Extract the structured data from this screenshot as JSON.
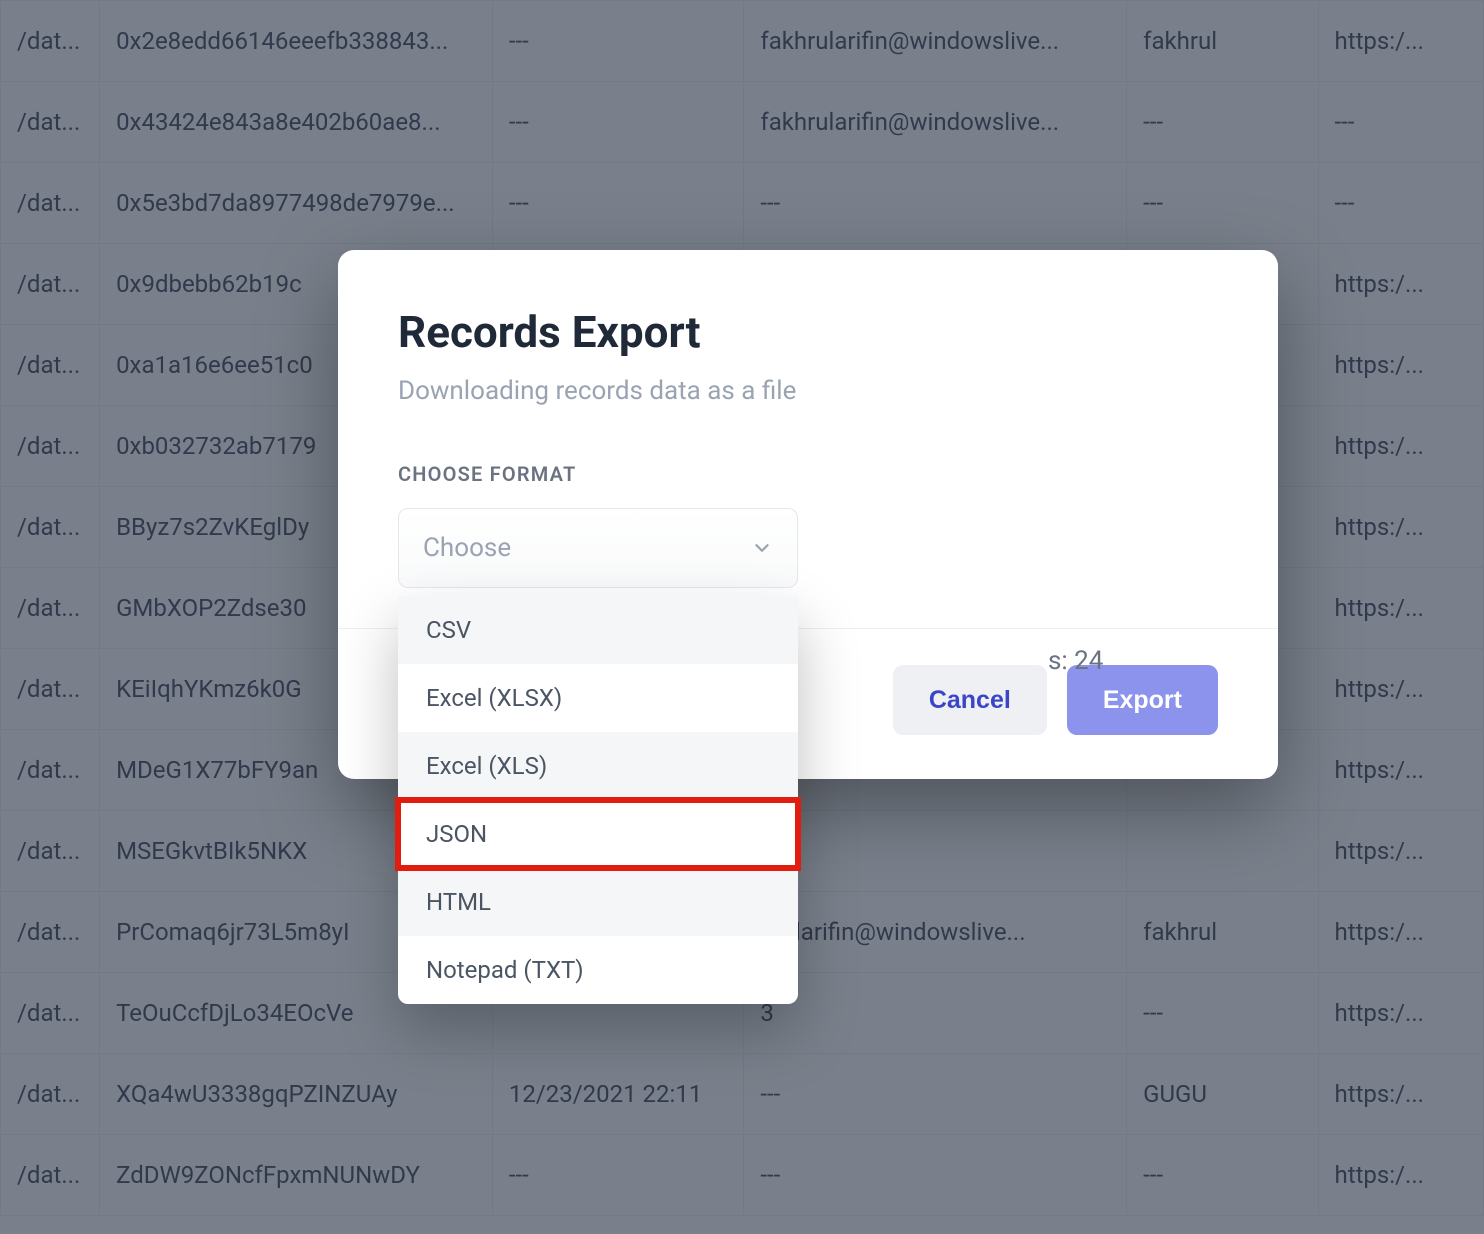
{
  "table": {
    "rows": [
      {
        "c0": "/dat...",
        "c1": "0x2e8edd66146eeefb338843...",
        "c2": "---",
        "c3": "fakhrularifin@windowslive...",
        "c4": "fakhrul",
        "c5": "https:/..."
      },
      {
        "c0": "/dat...",
        "c1": "0x43424e843a8e402b60ae8...",
        "c2": "---",
        "c3": "fakhrularifin@windowslive...",
        "c4": "---",
        "c5": "---"
      },
      {
        "c0": "/dat...",
        "c1": "0x5e3bd7da8977498de7979e...",
        "c2": "---",
        "c3": "---",
        "c4": "---",
        "c5": "---"
      },
      {
        "c0": "/dat...",
        "c1": "0x9dbebb62b19c",
        "c2": "",
        "c3": "",
        "c4": "",
        "c5": "https:/..."
      },
      {
        "c0": "/dat...",
        "c1": "0xa1a16e6ee51c0",
        "c2": "",
        "c3": "",
        "c4": "",
        "c5": "https:/..."
      },
      {
        "c0": "/dat...",
        "c1": "0xb032732ab7179",
        "c2": "",
        "c3": "",
        "c4": "",
        "c5": "https:/..."
      },
      {
        "c0": "/dat...",
        "c1": "BByz7s2ZvKEglDy",
        "c2": "",
        "c3": "",
        "c4": "",
        "c5": "https:/..."
      },
      {
        "c0": "/dat...",
        "c1": "GMbXOP2Zdse30",
        "c2": "",
        "c3": "",
        "c4": "",
        "c5": "https:/..."
      },
      {
        "c0": "/dat...",
        "c1": "KEiIqhYKmz6k0G",
        "c2": "",
        "c3": "",
        "c4": "",
        "c5": "https:/..."
      },
      {
        "c0": "/dat...",
        "c1": "MDeG1X77bFY9an",
        "c2": "",
        "c3": "",
        "c4": "",
        "c5": "https:/..."
      },
      {
        "c0": "/dat...",
        "c1": "MSEGkvtBIk5NKX",
        "c2": "",
        "c3": "",
        "c4": "",
        "c5": "https:/..."
      },
      {
        "c0": "/dat...",
        "c1": "PrComaq6jr73L5m8yI",
        "c2": "",
        "c3": "hrularifin@windowslive...",
        "c4": "fakhrul",
        "c5": "https:/..."
      },
      {
        "c0": "/dat...",
        "c1": "TeOuCcfDjLo34EOcVe",
        "c2": "",
        "c3": "3",
        "c4": "---",
        "c5": "https:/..."
      },
      {
        "c0": "/dat...",
        "c1": "XQa4wU3338gqPZINZUAy",
        "c2": "12/23/2021 22:11",
        "c3": "---",
        "c4": "GUGU",
        "c5": "https:/..."
      },
      {
        "c0": "/dat...",
        "c1": "ZdDW9ZONcfFpxmNUNwDY",
        "c2": "---",
        "c3": "---",
        "c4": "---",
        "c5": "https:/..."
      }
    ]
  },
  "modal": {
    "title": "Records Export",
    "subtitle": "Downloading records data as a file",
    "section_label": "CHOOSE FORMAT",
    "select_placeholder": "Choose",
    "columns_info": "s: 24",
    "cancel_label": "Cancel",
    "export_label": "Export",
    "options": {
      "csv": "CSV",
      "xlsx": "Excel (XLSX)",
      "xls": "Excel (XLS)",
      "json": "JSON",
      "html": "HTML",
      "txt": "Notepad (TXT)"
    }
  }
}
